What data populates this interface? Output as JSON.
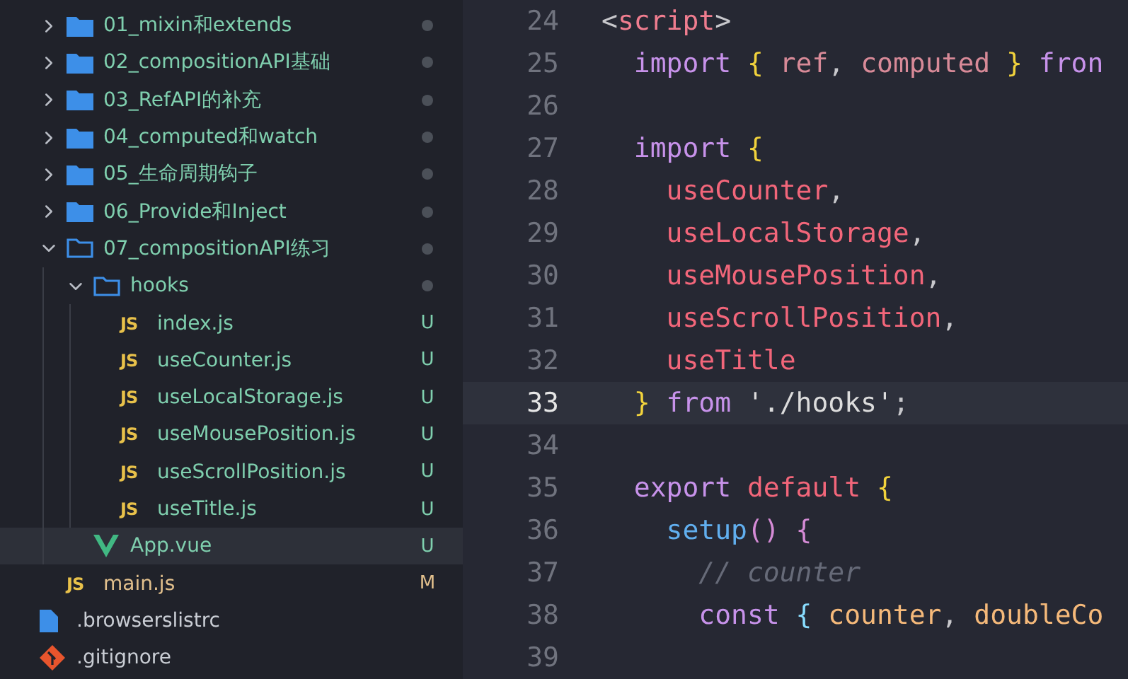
{
  "explorer": {
    "items": [
      {
        "kind": "group",
        "children": [
          {
            "kind": "folder",
            "label": "01_mixin和extends",
            "expanded": false,
            "color": "#7fcfae",
            "dot": true,
            "selected": false
          },
          {
            "kind": "folder",
            "label": "02_compositionAPI基础",
            "expanded": false,
            "color": "#7fcfae",
            "dot": true,
            "selected": false
          },
          {
            "kind": "folder",
            "label": "03_RefAPI的补充",
            "expanded": false,
            "color": "#7fcfae",
            "dot": true,
            "selected": false
          },
          {
            "kind": "folder",
            "label": "04_computed和watch",
            "expanded": false,
            "color": "#7fcfae",
            "dot": true,
            "selected": false
          },
          {
            "kind": "folder",
            "label": "05_生命周期钩子",
            "expanded": false,
            "color": "#7fcfae",
            "dot": true,
            "selected": false
          },
          {
            "kind": "folder",
            "label": "06_Provide和Inject",
            "expanded": false,
            "color": "#7fcfae",
            "dot": true,
            "selected": false
          },
          {
            "kind": "folder",
            "label": "07_compositionAPI练习",
            "expanded": true,
            "color": "#7fcfae",
            "dot": true,
            "selected": false,
            "children": [
              {
                "kind": "folder",
                "label": "hooks",
                "expanded": true,
                "color": "#7fcfae",
                "dot": true,
                "selected": false,
                "children": [
                  {
                    "kind": "js",
                    "icon_text": "JS",
                    "label": "index.js",
                    "color": "#7fcfae",
                    "badge": "U",
                    "selected": false
                  },
                  {
                    "kind": "js",
                    "icon_text": "JS",
                    "label": "useCounter.js",
                    "color": "#7fcfae",
                    "badge": "U",
                    "selected": false
                  },
                  {
                    "kind": "js",
                    "icon_text": "JS",
                    "label": "useLocalStorage.js",
                    "color": "#7fcfae",
                    "badge": "U",
                    "selected": false
                  },
                  {
                    "kind": "js",
                    "icon_text": "JS",
                    "label": "useMousePosition.js",
                    "color": "#7fcfae",
                    "badge": "U",
                    "selected": false
                  },
                  {
                    "kind": "js",
                    "icon_text": "JS",
                    "label": "useScrollPosition.js",
                    "color": "#7fcfae",
                    "badge": "U",
                    "selected": false
                  },
                  {
                    "kind": "js",
                    "icon_text": "JS",
                    "label": "useTitle.js",
                    "color": "#7fcfae",
                    "badge": "U",
                    "selected": false
                  }
                ]
              },
              {
                "kind": "vue",
                "label": "App.vue",
                "color": "#7fcfae",
                "badge": "U",
                "selected": true
              }
            ]
          },
          {
            "kind": "js",
            "icon_text": "JS",
            "label": "main.js",
            "color": "#e2c08d",
            "badge": "M",
            "selected": false
          }
        ]
      },
      {
        "kind": "file",
        "label": ".browserslistrc",
        "color": "#c9cdd4",
        "selected": false
      },
      {
        "kind": "git",
        "label": ".gitignore",
        "color": "#c9cdd4",
        "selected": false
      }
    ]
  },
  "editor": {
    "lines": [
      {
        "number": "24",
        "current": false,
        "tokens": [
          {
            "kind": "punct",
            "text": "<"
          },
          {
            "kind": "tag",
            "text": "script"
          },
          {
            "kind": "punct",
            "text": ">"
          }
        ]
      },
      {
        "number": "25",
        "current": false,
        "tokens": [
          {
            "kind": "keyword",
            "text": "  import "
          },
          {
            "kind": "brace",
            "text": "{ "
          },
          {
            "kind": "dim",
            "text": "ref"
          },
          {
            "kind": "punct",
            "text": ", "
          },
          {
            "kind": "dim",
            "text": "computed "
          },
          {
            "kind": "brace",
            "text": "} "
          },
          {
            "kind": "keyword",
            "text": "fron"
          }
        ]
      },
      {
        "number": "26",
        "current": false
      },
      {
        "number": "27",
        "current": false,
        "tokens": [
          {
            "kind": "keyword",
            "text": "  import "
          },
          {
            "kind": "brace",
            "text": "{"
          }
        ]
      },
      {
        "number": "28",
        "current": false,
        "tokens": [
          {
            "kind": "ident",
            "text": "    useCounter"
          },
          {
            "kind": "punct",
            "text": ","
          }
        ]
      },
      {
        "number": "29",
        "current": false,
        "tokens": [
          {
            "kind": "ident",
            "text": "    useLocalStorage"
          },
          {
            "kind": "punct",
            "text": ","
          }
        ]
      },
      {
        "number": "30",
        "current": false,
        "tokens": [
          {
            "kind": "ident",
            "text": "    useMousePosition"
          },
          {
            "kind": "punct",
            "text": ","
          }
        ]
      },
      {
        "number": "31",
        "current": false,
        "tokens": [
          {
            "kind": "ident",
            "text": "    useScrollPosition"
          },
          {
            "kind": "punct",
            "text": ","
          }
        ]
      },
      {
        "number": "32",
        "current": false,
        "tokens": [
          {
            "kind": "ident",
            "text": "    useTitle"
          }
        ]
      },
      {
        "number": "33",
        "current": true,
        "tokens": [
          {
            "kind": "brace",
            "text": "  } "
          },
          {
            "kind": "keyword",
            "text": "from "
          },
          {
            "kind": "string",
            "text": "'./hooks'"
          },
          {
            "kind": "punct",
            "text": ";"
          }
        ]
      },
      {
        "number": "34",
        "current": false
      },
      {
        "number": "35",
        "current": false,
        "tokens": [
          {
            "kind": "keyword",
            "text": "  export "
          },
          {
            "kind": "ident",
            "text": "default "
          },
          {
            "kind": "brace",
            "text": "{"
          }
        ]
      },
      {
        "number": "36",
        "current": false,
        "tokens": [
          {
            "kind": "func",
            "text": "    setup"
          },
          {
            "kind": "paren",
            "text": "() {"
          }
        ]
      },
      {
        "number": "37",
        "current": false,
        "tokens": [
          {
            "kind": "comment",
            "text": "      // counter"
          }
        ]
      },
      {
        "number": "38",
        "current": false,
        "tokens": [
          {
            "kind": "keyword",
            "text": "      const "
          },
          {
            "kind": "cyan",
            "text": "{ "
          },
          {
            "kind": "var",
            "text": "counter"
          },
          {
            "kind": "punct",
            "text": ", "
          },
          {
            "kind": "var",
            "text": "doubleCo"
          }
        ]
      },
      {
        "number": "39",
        "current": false
      }
    ]
  }
}
